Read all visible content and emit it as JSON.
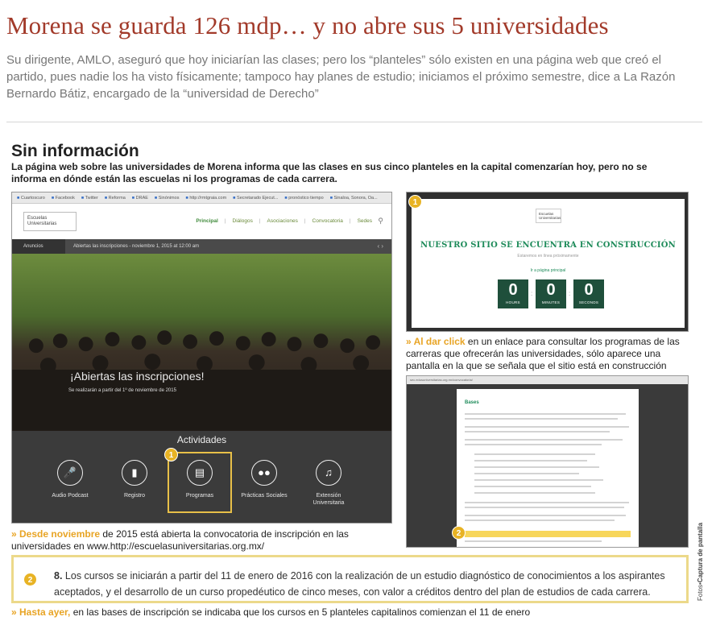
{
  "article": {
    "headline": "Morena se guarda 126 mdp… y no abre sus 5 universidades",
    "deck": "Su dirigente, AMLO, aseguró que hoy iniciarían las clases; pero los “planteles” sólo existen en una página web que creó el partido, pues nadie los ha visto físicamente; tampoco hay planes de estudio; iniciamos el próximo semestre, dice a La Razón Bernardo Bátiz, encargado de la “universidad de Derecho”"
  },
  "infographic": {
    "title": "Sin información",
    "subtitle": "La página web sobre las universidades de Morena informa que las clases en sus cinco planteles en la capital comenzarían hoy, pero no se informa en dónde están las escuelas ni los programas de cada carrera.",
    "left_shot": {
      "bookmarks": [
        "Cuartoscuro",
        "Facebook",
        "Twitter",
        "Reforma",
        "DRAE",
        "Sinónimos",
        "http://rmtgraia.com",
        "Secretarado Ejecut...",
        "pronóstico tiempo",
        "Sinaloa, Sonora, Oa..."
      ],
      "logo": "Escuelas Universitarias",
      "nav": [
        "Principal",
        "Diálogos",
        "Asociaciones",
        "Convocatoria",
        "Sedes"
      ],
      "ticker_label": "Anuncios",
      "ticker_text": "Abiertas las inscripciones - noviembre 1, 2015 at 12:00 am",
      "promo_title": "¡Abiertas las inscripciones!",
      "promo_sub": "Se realizarán a partir del 1º de noviembre de 2015",
      "activities_title": "Actividades",
      "activities": [
        {
          "label": "Audio Podcast",
          "icon": "microphone-icon"
        },
        {
          "label": "Registro",
          "icon": "chart-icon"
        },
        {
          "label": "Programas",
          "icon": "book-icon"
        },
        {
          "label": "Prácticas Sociales",
          "icon": "people-icon"
        },
        {
          "label": "Extensión Universitaria",
          "icon": "music-icon"
        }
      ],
      "badge": "1"
    },
    "right_top_shot": {
      "badge": "1",
      "logo": "Escuelas Universitarias",
      "heading": "NUESTRO SITIO SE ENCUENTRA EN CONSTRUCCIÓN",
      "small": "Estaremos en línea próximamente",
      "link": "Ir a página principal",
      "countdown": [
        {
          "value": "0",
          "unit": "HOURS"
        },
        {
          "value": "0",
          "unit": "MINUTES"
        },
        {
          "value": "0",
          "unit": "SECONDS"
        }
      ]
    },
    "caption_right": {
      "lead": "» Al dar click",
      "text": " en un enlace para consultar los programas de las carreras que ofrecerán las universidades, sólo aparece una pantalla en la que se señala que el sitio está en construcción"
    },
    "right_bottom_shot": {
      "url": "sec.edusuniversitarias.org.mx/convocatoria/",
      "title": "Bases",
      "badge": "2"
    },
    "caption_left": {
      "lead": "» Desde noviembre",
      "text": " de 2015 está abierta la convocatoria de inscripción en las universidades en www.http://escuelasuniversitarias.org.mx/"
    },
    "quote": {
      "badge": "2",
      "number": "8.",
      "text": " Los cursos se iniciarán a partir del 11 de enero de 2016 con la realización de un estudio diagnóstico de conocimientos a los aspirantes aceptados, y el desarrollo de un curso propedéutico de cinco meses, con valor a créditos dentro del plan de estudios de cada carrera."
    },
    "caption_bottom": {
      "lead": "» Hasta ayer,",
      "text": " en las bases de inscripción se indicaba que los cursos en 5 planteles capitalinos comienzan el 11 de enero"
    },
    "credit": {
      "prefix": "Fotos•",
      "label": "Captura de pantalla"
    }
  }
}
